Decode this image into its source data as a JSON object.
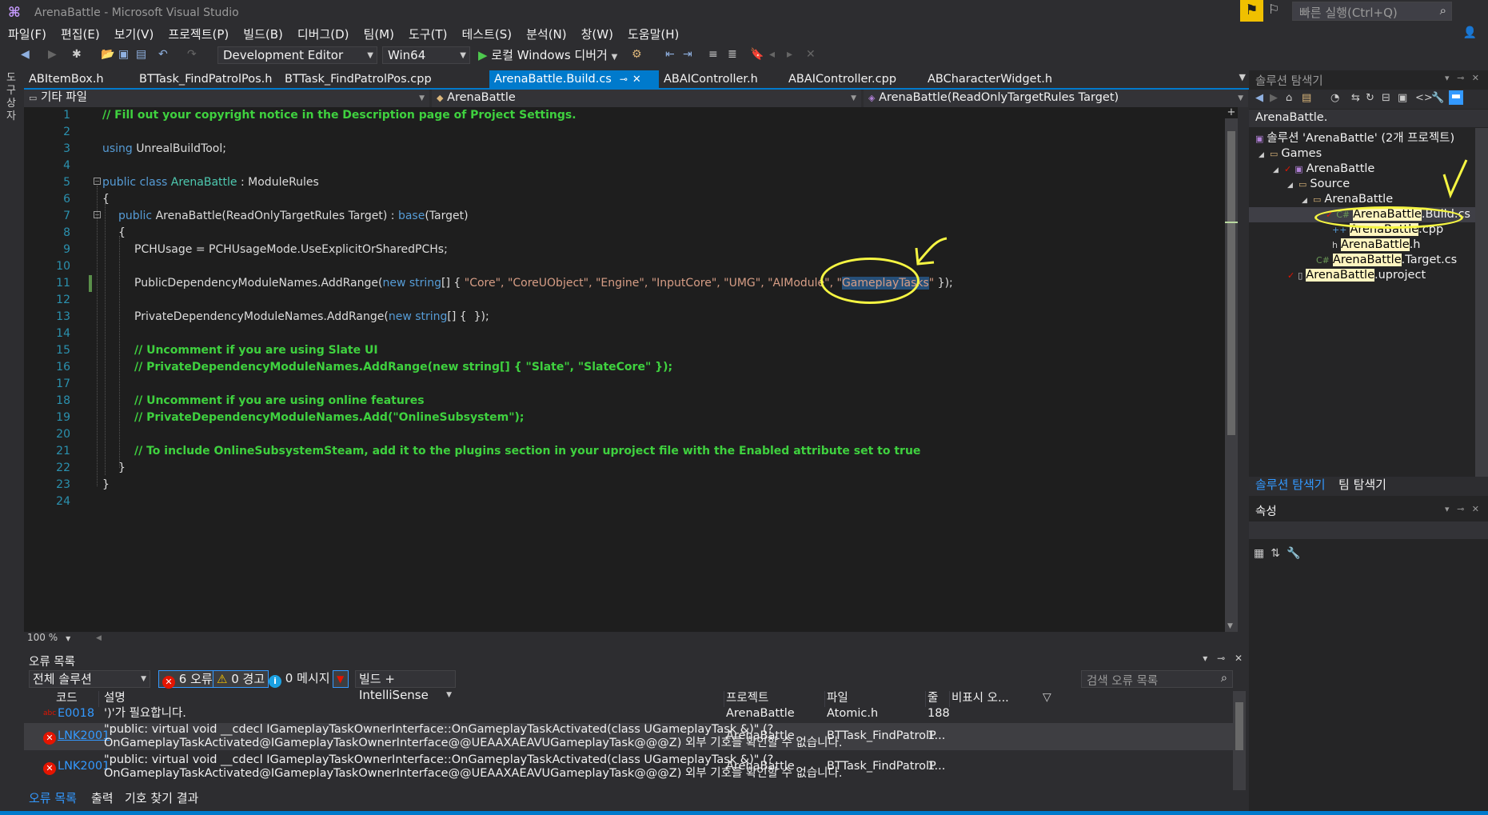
{
  "window": {
    "title": "ArenaBattle - Microsoft Visual Studio"
  },
  "quick_launch": {
    "placeholder": "빠른 실행(Ctrl+Q)"
  },
  "menu": [
    "파일(F)",
    "편집(E)",
    "보기(V)",
    "프로젝트(P)",
    "빌드(B)",
    "디버그(D)",
    "팀(M)",
    "도구(T)",
    "테스트(S)",
    "분석(N)",
    "창(W)",
    "도움말(H)"
  ],
  "toolbar": {
    "configuration": "Development Editor",
    "platform": "Win64",
    "run_label": "로컬 Windows 디버거"
  },
  "left_strip": {
    "label": "도구 상자"
  },
  "tabs": [
    {
      "label": "ABItemBox.h",
      "active": false
    },
    {
      "label": "BTTask_FindPatrolPos.h",
      "active": false
    },
    {
      "label": "BTTask_FindPatrolPos.cpp",
      "active": false
    },
    {
      "label": "ArenaBattle.Build.cs",
      "active": true
    },
    {
      "label": "ABAIController.h",
      "active": false
    },
    {
      "label": "ABAIController.cpp",
      "active": false
    },
    {
      "label": "ABCharacterWidget.h",
      "active": false
    }
  ],
  "navbar": {
    "scope": "기타 파일",
    "class": "ArenaBattle",
    "member": "ArenaBattle(ReadOnlyTargetRules Target)"
  },
  "editor": {
    "zoom": "100 %",
    "line_numbers": [
      "1",
      "2",
      "3",
      "4",
      "5",
      "6",
      "7",
      "8",
      "9",
      "10",
      "11",
      "12",
      "13",
      "14",
      "15",
      "16",
      "17",
      "18",
      "19",
      "20",
      "21",
      "22",
      "23",
      "24"
    ],
    "lines": {
      "l1": "// Fill out your copyright notice in the Description page of Project Settings.",
      "l3a": "using",
      "l3b": " UnrealBuildTool;",
      "l5a": "public class",
      "l5b": " ArenaBattle",
      "l5c": " : ModuleRules",
      "l6": "{",
      "l7a": "public",
      "l7b": " ArenaBattle(ReadOnlyTargetRules Target) : ",
      "l7c": "base",
      "l7d": "(Target)",
      "l8": "{",
      "l9": "PCHUsage = PCHUsageMode.UseExplicitOrSharedPCHs;",
      "l11a": "PublicDependencyModuleNames.AddRange(",
      "l11b": "new string",
      "l11c": "[] { ",
      "l11d": "\"Core\", \"CoreUObject\", \"Engine\", \"InputCore\", \"UMG\", \"AIModule\", \"",
      "l11e": "GameplayTasks",
      "l11f": "\"",
      "l11g": " });",
      "l13a": "PrivateDependencyModuleNames.AddRange(",
      "l13b": "new string",
      "l13c": "[] {  });",
      "l15": "// Uncomment if you are using Slate UI",
      "l16": "// PrivateDependencyModuleNames.AddRange(new string[] { \"Slate\", \"SlateCore\" });",
      "l18": "// Uncomment if you are using online features",
      "l19": "// PrivateDependencyModuleNames.Add(\"OnlineSubsystem\");",
      "l21": "// To include OnlineSubsystemSteam, add it to the plugins section in your uproject file with the Enabled attribute set to true",
      "l22": "}",
      "l23": "}"
    }
  },
  "error_list": {
    "title": "오류 목록",
    "scope": "전체 솔루션",
    "errors": "6 오류",
    "warnings": "0 경고",
    "messages": "0 메시지",
    "source": "빌드 + IntelliSense",
    "search_placeholder": "검색 오류 목록",
    "columns": [
      "코드",
      "설명",
      "프로젝트",
      "파일",
      "줄",
      "비표시 오..."
    ],
    "rows": [
      {
        "code": "E0018",
        "desc1": "')'가 필요합니다.",
        "desc2": "",
        "project": "ArenaBattle",
        "file": "Atomic.h",
        "line": "188"
      },
      {
        "code": "LNK2001",
        "desc1": "\"public: virtual void __cdecl IGameplayTaskOwnerInterface::OnGameplayTaskActivated(class UGameplayTask &)\" (?",
        "desc2": "OnGameplayTaskActivated@IGameplayTaskOwnerInterface@@UEAAXAEAVUGameplayTask@@@Z) 외부 기호를 확인할 수 없습니다.",
        "project": "ArenaBattle",
        "file": "BTTask_FindPatrolP...",
        "line": "1"
      },
      {
        "code": "LNK2001",
        "desc1": "\"public: virtual void __cdecl IGameplayTaskOwnerInterface::OnGameplayTaskActivated(class UGameplayTask &)\" (?",
        "desc2": "OnGameplayTaskActivated@IGameplayTaskOwnerInterface@@UEAAXAEAVUGameplayTask@@@Z) 외부 기호를 확인할 수 없습니다.",
        "project": "ArenaBattle",
        "file": "BTTask_FindPatrolP...",
        "line": "1"
      }
    ]
  },
  "bottom_tabs": [
    "오류 목록",
    "출력",
    "기호 찾기 결과"
  ],
  "solution_explorer": {
    "title": "솔루션 탐색기",
    "search_value": "ArenaBattle.",
    "tree": {
      "solution": "솔루션 'ArenaBattle' (2개 프로젝트)",
      "games": "Games",
      "project": "ArenaBattle",
      "source": "Source",
      "folder": "ArenaBattle",
      "build_hl": "ArenaBattle",
      "build_rest": ".Build.cs",
      "cpp_hl": "ArenaBattle",
      "cpp_rest": ".cpp",
      "h_hl": "ArenaBattle",
      "h_rest": ".h",
      "target_hl": "ArenaBattle",
      "target_rest": ".Target.cs",
      "uproject_hl": "ArenaBattle",
      "uproject_rest": ".uproject"
    }
  },
  "panel_tabs": {
    "solution_explorer": "솔루션 탐색기",
    "team_explorer": "팀 탐색기"
  },
  "properties": {
    "title": "속성"
  },
  "colors": {
    "accent": "#007acc",
    "editor_bg": "#1e1e1e",
    "comment": "#3fd13f",
    "keyword": "#569cd6",
    "string": "#d69d85",
    "annotation": "#f5f542",
    "error": "#e51400"
  }
}
